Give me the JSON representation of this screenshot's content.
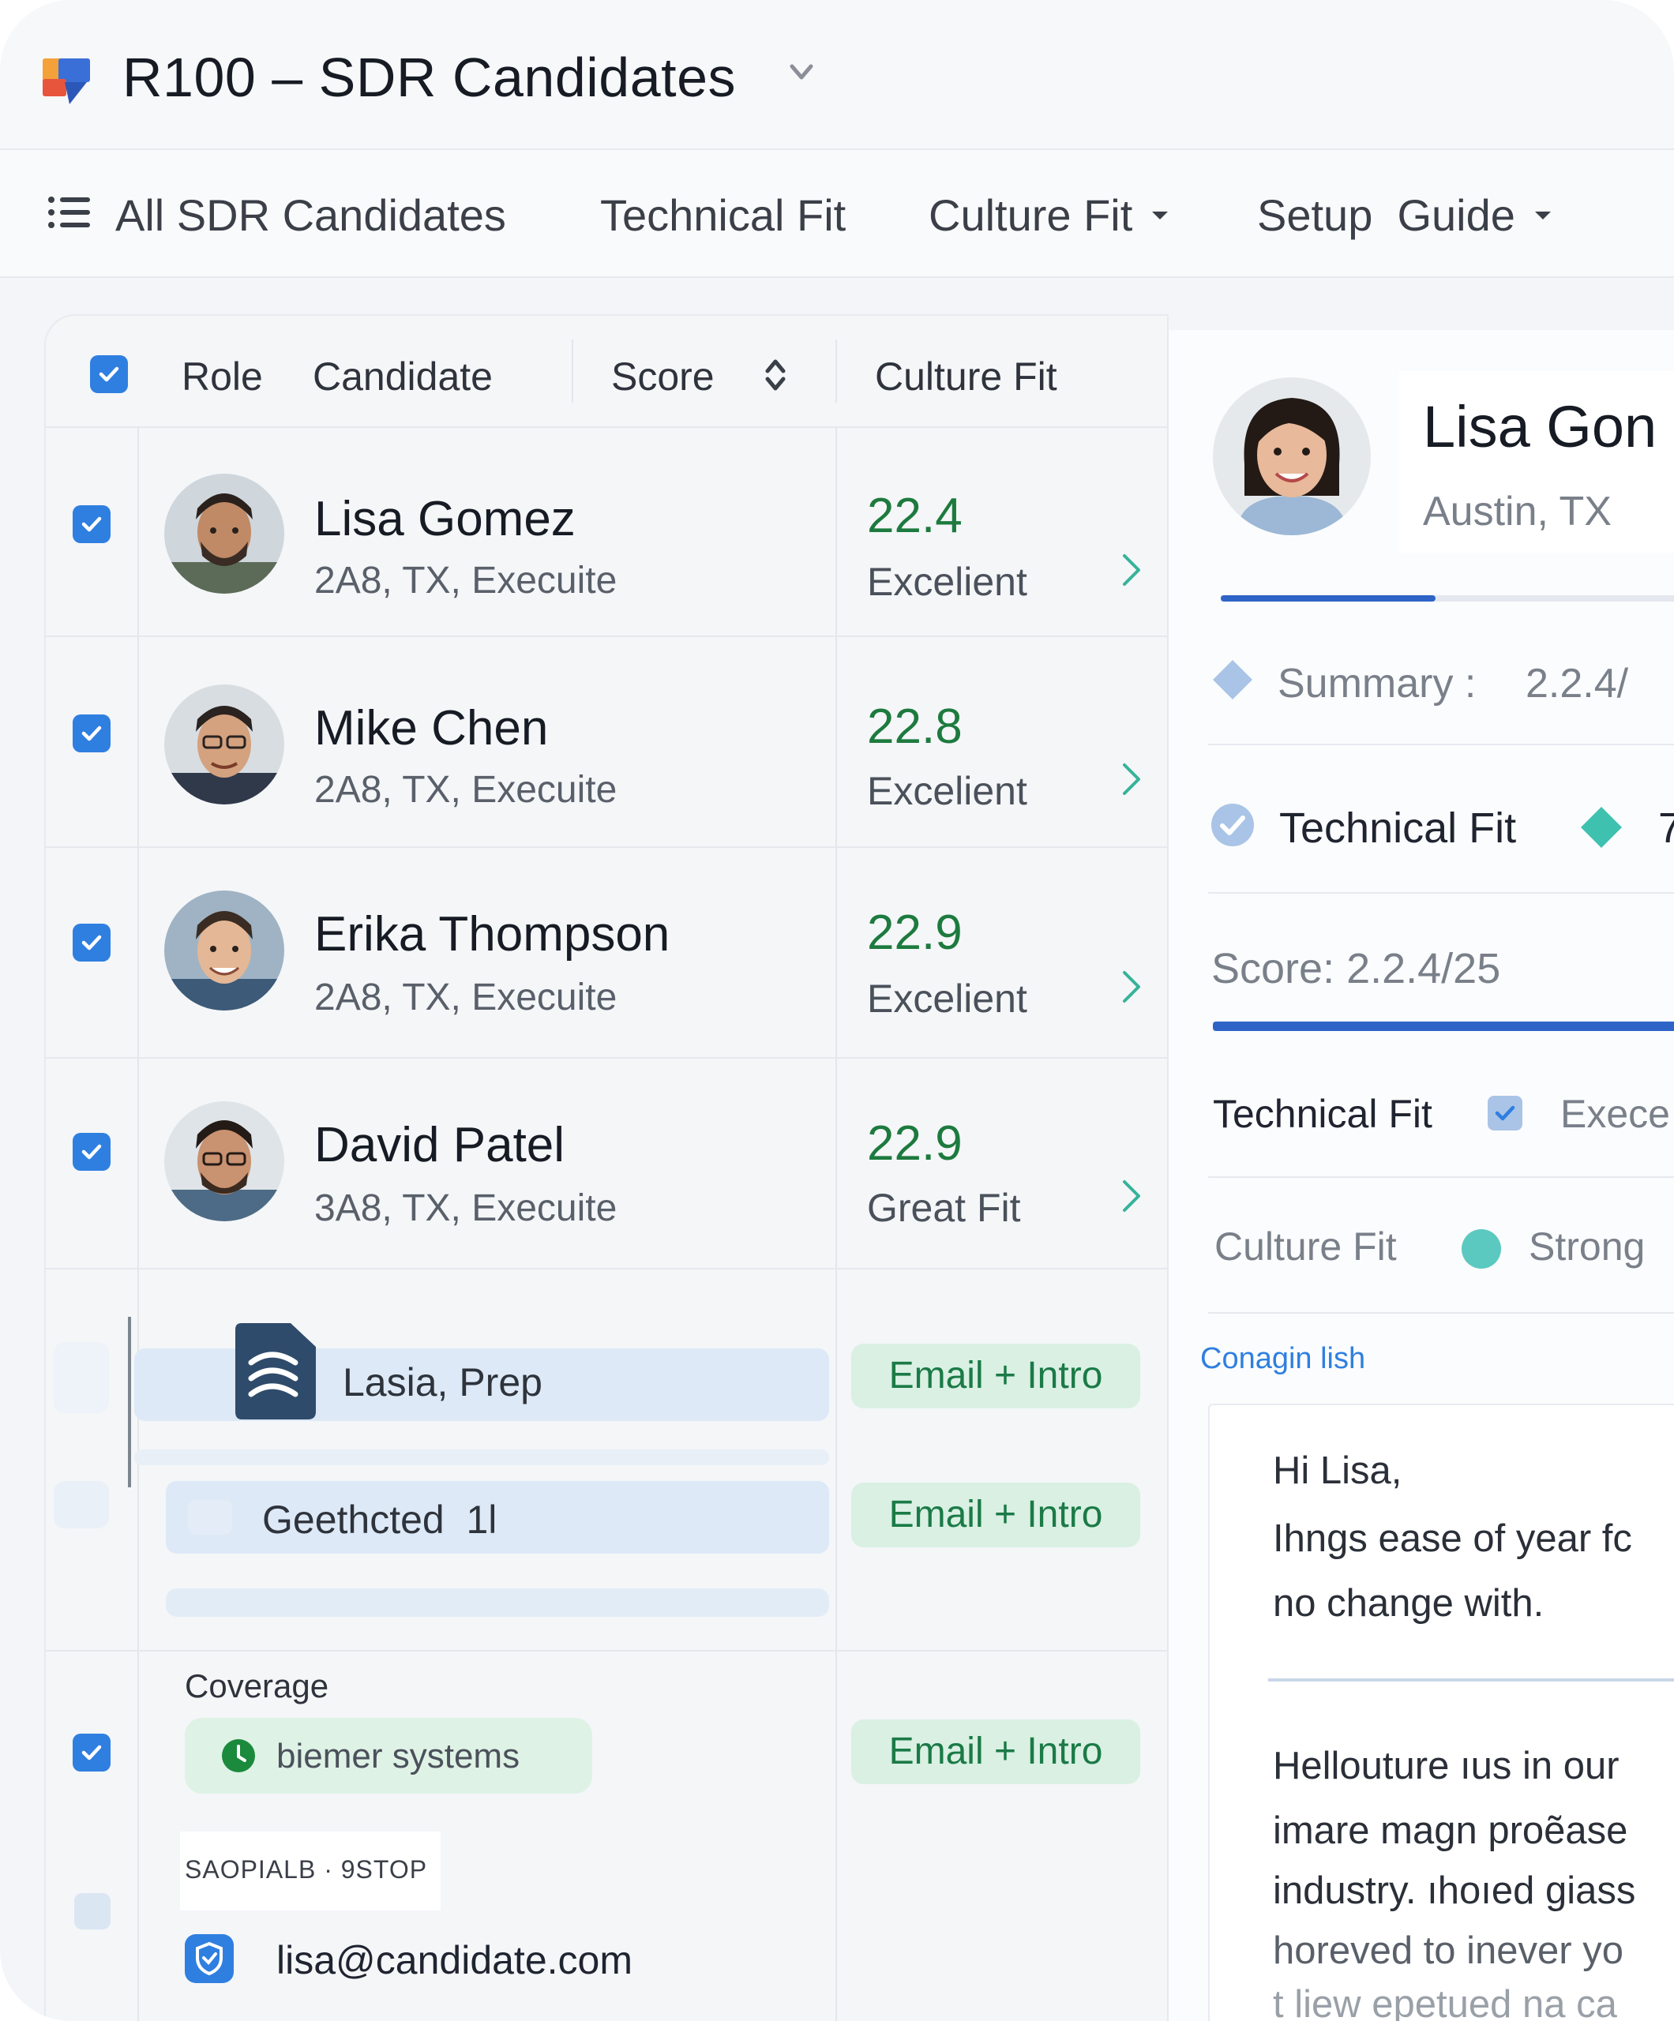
{
  "header": {
    "title": "R100 – SDR Candidates"
  },
  "nav": {
    "items": [
      {
        "label": "All SDR Candidates"
      },
      {
        "label": "Technical Fit"
      },
      {
        "label": "Culture Fit"
      },
      {
        "label": "Setup  Guide"
      }
    ]
  },
  "table": {
    "headers": {
      "role": "Role",
      "candidate": "Candidate",
      "score": "Score",
      "culture_fit": "Culture Fit"
    },
    "rows": [
      {
        "name": "Lisa Gomez",
        "sub": "2A8, TX, Execuite",
        "score": "22.4",
        "fit": "Excelient"
      },
      {
        "name": "Mike Chen",
        "sub": "2A8, TX, Execuite",
        "score": "22.8",
        "fit": "Excelient"
      },
      {
        "name": "Erika Thompson",
        "sub": "2A8, TX, Execuite",
        "score": "22.9",
        "fit": "Excelient"
      },
      {
        "name": "David Patel",
        "sub": "3A8, TX, Execuite",
        "score": "22.9",
        "fit": "Great Fit"
      }
    ],
    "sub_items": [
      {
        "label": "Lasia, Prep",
        "action": "Email + Intro"
      },
      {
        "label": "Geethcted  1l",
        "action": "Email + Intro"
      }
    ],
    "coverage": {
      "label": "Coverage",
      "chip": "biemer systems",
      "action": "Email + Intro"
    },
    "contact": {
      "tag": "SAOPIALB · 9STOP",
      "email": "lisa@candidate.com"
    }
  },
  "panel": {
    "name": "Lisa Gon",
    "location": "Austin, TX",
    "summary_label": "Summary :",
    "summary_value": "2.2.4/",
    "technical_fit": "Technical Fit",
    "tech_cut": "7",
    "score_text": "Score: 2.2.4/25",
    "tech_fit_row_label": "Technical Fit",
    "tech_fit_row_value": "Exece",
    "culture_fit_label": "Culture Fit",
    "culture_fit_value": "Strong",
    "link": "Conagin lish",
    "email_lines_1": [
      "Hi Lisa,",
      "Ihngs ease of year fc",
      "no change with."
    ],
    "email_lines_2": [
      "Hellouture ıus in our",
      "imare magn proẽase",
      "industry. ıhoıed giass",
      "horeved to inever yo",
      "t liew epetued na ca"
    ]
  },
  "colors": {
    "accent": "#2f7fe0",
    "score_green": "#1d7a3e",
    "pill_green_bg": "#d9f0e3",
    "teal": "#3fc1b0",
    "progress_blue": "#2e64c7"
  }
}
